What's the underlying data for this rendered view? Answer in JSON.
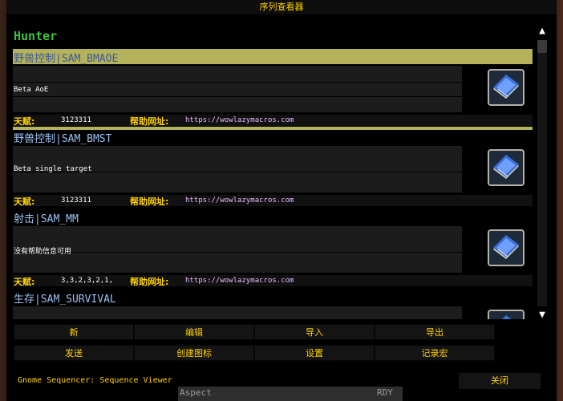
{
  "window": {
    "title": "序列查看器",
    "class_title": "Hunter",
    "footer_label": "Gnome Sequencer: Sequence Viewer",
    "close_label": "关闭"
  },
  "labels": {
    "talent": "天赋:",
    "help_url": "帮助网址:"
  },
  "sequences": [
    {
      "name": "野兽控制|SAM_BMAOE",
      "help": "Beta AoE",
      "talents": "3123311",
      "url": "https://wowlazymacros.com",
      "selected": true
    },
    {
      "name": "野兽控制|SAM_BMST",
      "help": "Beta single target",
      "talents": "3123311",
      "url": "https://wowlazymacros.com",
      "selected": false
    },
    {
      "name": "射击|SAM_MM",
      "help": "没有帮助信息可用",
      "talents": "3,3,2,3,2,1,",
      "url": "https://wowlazymacros.com",
      "selected": false
    },
    {
      "name": "生存|SAM_SURVIVAL",
      "help": "",
      "talents": "",
      "url": "",
      "selected": false
    }
  ],
  "buttons": {
    "new": "新",
    "edit": "编辑",
    "import": "导入",
    "export": "导出",
    "send": "发送",
    "create_icon": "创建图标",
    "settings": "设置",
    "record_macro": "记录宏"
  },
  "bottom_bar": {
    "left": "Aspect",
    "right": "RDY"
  },
  "icons": {
    "scroll_up": "chevron-up-icon",
    "scroll_down": "chevron-down-icon",
    "sequence": "spellbook-icon"
  }
}
